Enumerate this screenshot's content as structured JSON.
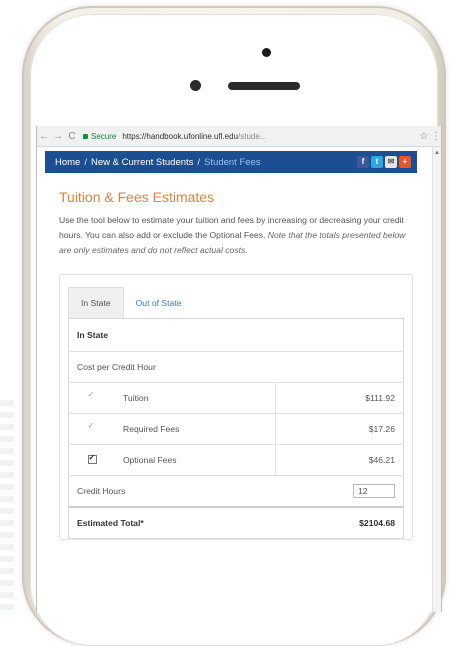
{
  "browser": {
    "back": "←",
    "forward": "→",
    "reload": "C",
    "secure_label": "Secure",
    "url_host": "https://handbook.ufonline.ufl.edu",
    "url_path": "/stude...",
    "star": "☆",
    "menu": "⋮"
  },
  "breadcrumb": {
    "home": "Home",
    "section": "New & Current Students",
    "current": "Student Fees",
    "separator": "/"
  },
  "social": [
    "f",
    "t",
    "✉",
    "+"
  ],
  "page": {
    "title": "Tuition & Fees Estimates",
    "intro_main": "Use the tool below to estimate your tuition and fees by increasing or decreasing your credit hours. You can also add or exclude the Optional Fees. ",
    "intro_note": "Note that the totals presented below are only estimates and do not reflect actual costs."
  },
  "tabs": [
    {
      "label": "In State",
      "active": true
    },
    {
      "label": "Out of State",
      "active": false
    }
  ],
  "table": {
    "header": "In State",
    "cost_label": "Cost per Credit Hour",
    "rows": [
      {
        "label": "Tuition",
        "amount": "$111.92"
      },
      {
        "label": "Required Fees",
        "amount": "$17.26"
      },
      {
        "label": "Optional Fees",
        "amount": "$46.21"
      }
    ],
    "credit_hours_label": "Credit Hours",
    "credit_hours_value": "12",
    "total_label": "Estimated Total*",
    "total_value": "$2104.68"
  }
}
